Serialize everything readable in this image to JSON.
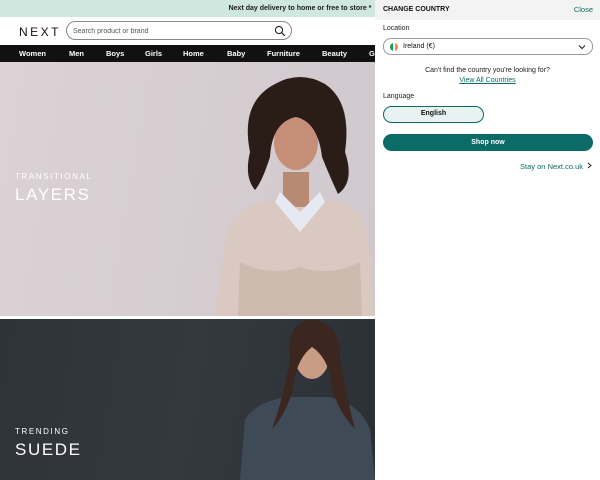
{
  "banner": {
    "text": "Next day delivery to home or free to store *"
  },
  "header": {
    "logo": "NEXT",
    "search": {
      "placeholder": "Search product or brand",
      "value": ""
    }
  },
  "nav": {
    "items": [
      "Women",
      "Men",
      "Boys",
      "Girls",
      "Home",
      "Baby",
      "Furniture",
      "Beauty",
      "G"
    ]
  },
  "heroes": [
    {
      "kicker": "TRANSITIONAL",
      "headline": "LAYERS"
    },
    {
      "kicker": "TRENDING",
      "headline": "SUEDE"
    }
  ],
  "country_panel": {
    "title": "CHANGE COUNTRY",
    "close_label": "Close",
    "location_label": "Location",
    "selected_country": "Ireland (€)",
    "cant_find_text": "Can't find the country you're looking for?",
    "view_all_link": "View All Countries",
    "language_label": "Language",
    "language_option": "English",
    "shop_button": "Shop now",
    "stay_link": "Stay on Next.co.uk"
  },
  "colors": {
    "accent": "#0b6b66",
    "banner_bg": "#cfe8df",
    "nav_bg": "#111111",
    "flag": [
      "#169b62",
      "#ffffff",
      "#ff883e"
    ]
  },
  "icons": [
    "search-icon",
    "chevron-down-icon",
    "chevron-right-icon"
  ]
}
